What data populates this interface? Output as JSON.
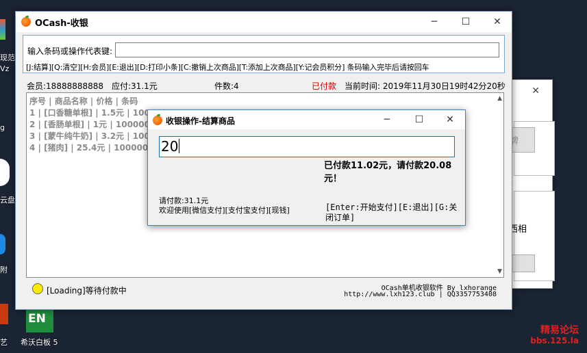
{
  "desktop": {
    "icons": [
      {
        "label": "现范",
        "sub": "Vz"
      },
      {
        "label": "g",
        "sub": ""
      },
      {
        "label": "云盘",
        "sub": ""
      },
      {
        "label": "附",
        "sub": ""
      },
      {
        "label": "希沃白板 5",
        "sub": ""
      }
    ],
    "tile_text": "EN",
    "left_edge_text": "艺",
    "watermark_line1": "精易论坛",
    "watermark_line2": "bbs.125.la"
  },
  "background_window": {
    "button_label": "牌",
    "text": "西相"
  },
  "main": {
    "title": "OCash-收银",
    "barcode_label": "输入条码或操作代表键:",
    "barcode_value": "",
    "hotkeys": "[J:结算][Q:清空][H:会员][E:退出][D:打印小条][C:撤销上次商品][T:添加上次商品][Y:记会员积分] 条码输入完毕后请按回车",
    "status": {
      "member": "会员:18888888888",
      "payable": "应付:31.1元",
      "count": "件数:4",
      "state": "已付款",
      "time": "当前时间: 2019年11月30日19时42分20秒"
    },
    "list": {
      "header": "序号 | 商品名称  |  价格  |  条码",
      "rows": [
        "1   | [口香糖单根]    | 1.5元 | 1000005",
        "2   | [香肠单根]    | 1元 | 1000006",
        "3   | [蒙牛纯牛奶]    | 3.2元 | 1000002",
        "4   | [猪肉]    | 25.4元 | 1000004"
      ]
    },
    "loading_text": "[Loading]等待付款中",
    "credit_line1": "OCash单机收银软件 By lxhorange",
    "credit_line2": "http://www.lxh123.club | QQ3357753408"
  },
  "modal": {
    "title": "收银操作-结算商品",
    "amount_value": "20",
    "paid_message": "已付款11.02元，请付款20.08元！",
    "due_text": "请付款:31.1元",
    "pay_methods": "欢迎使用[微信支付][支付宝支付][现钱]",
    "keys_text": "[Enter:开始支付][E:退出][G:关闭订单]"
  },
  "colors": {
    "accent": "#3e7fc1",
    "paid_red": "#d00000",
    "loading_dot": "#ffea00"
  }
}
